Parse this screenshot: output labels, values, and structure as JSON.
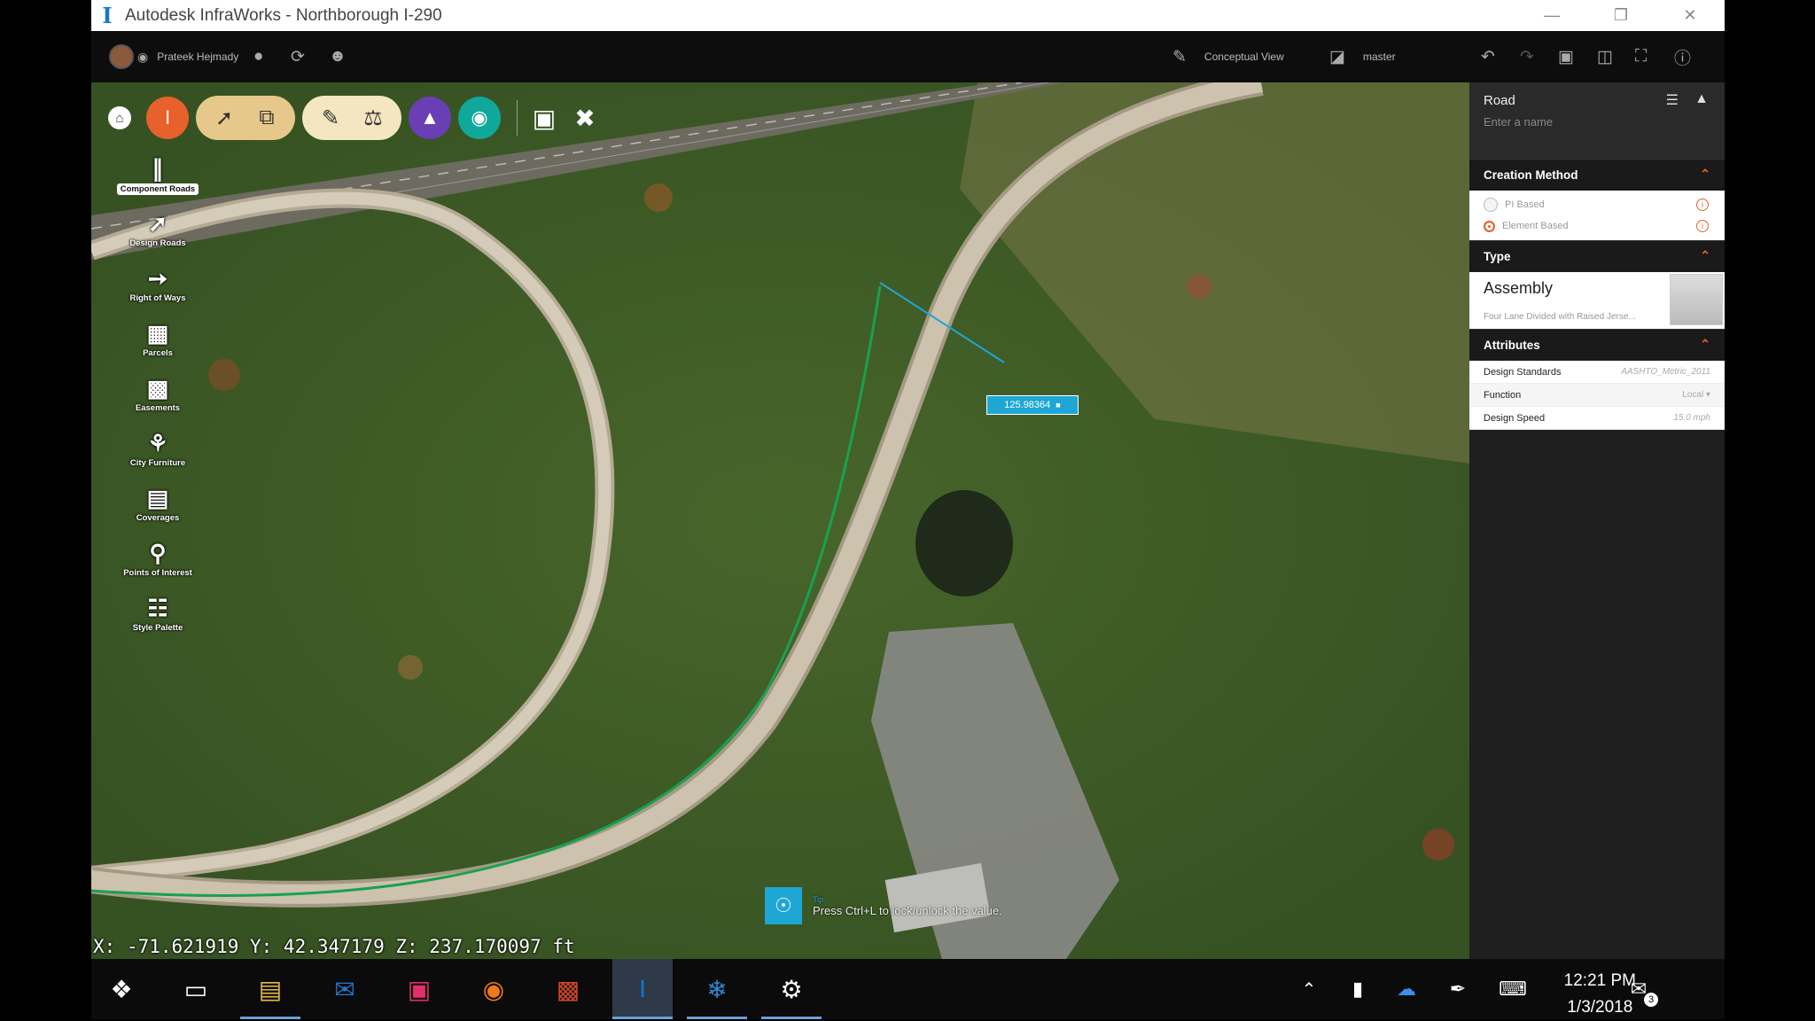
{
  "window": {
    "title": "Autodesk InfraWorks - Northborough I-290",
    "controls": [
      "minimize",
      "restore",
      "close"
    ]
  },
  "topbar": {
    "user_name": "Prateek Hejmady",
    "view_mode": "Conceptual View",
    "branch": "master"
  },
  "toolbar": {
    "buttons": [
      "home-icon",
      "infraworks-icon",
      "road-design-icon",
      "layers-icon",
      "sketch-icon",
      "analyze-icon",
      "bridge-icon",
      "drainage-icon",
      "present-icon",
      "tools-icon"
    ]
  },
  "leftnav": {
    "items": [
      {
        "label": "Component Roads",
        "active": true
      },
      {
        "label": "Design Roads"
      },
      {
        "label": "Right of Ways"
      },
      {
        "label": "Parcels"
      },
      {
        "label": "Easements"
      },
      {
        "label": "City Furniture"
      },
      {
        "label": "Coverages"
      },
      {
        "label": "Points of Interest"
      },
      {
        "label": "Style Palette"
      }
    ]
  },
  "panel": {
    "title": "Road",
    "name_placeholder": "Enter a name",
    "creation_method": {
      "heading": "Creation Method",
      "options": [
        {
          "label": "PI Based",
          "selected": false
        },
        {
          "label": "Element Based",
          "selected": true
        }
      ]
    },
    "type": {
      "heading": "Type",
      "name": "Assembly",
      "description": "Four Lane Divided with Raised Jerse..."
    },
    "attributes": {
      "heading": "Attributes",
      "rows": [
        {
          "label": "Design Standards",
          "value": "AASHTO_Metric_2011"
        },
        {
          "label": "Function",
          "value": "Local"
        },
        {
          "label": "Design Speed",
          "value": "15.0 mph"
        }
      ]
    }
  },
  "viewport": {
    "coordinates": "X: -71.621919 Y: 42.347179 Z: 237.170097 ft",
    "measure_value": "125.98364",
    "tip_label": "Tip",
    "tip_text": "Press Ctrl+L to lock/unlock the value."
  },
  "taskbar": {
    "time": "12:21 PM",
    "date": "1/3/2018",
    "notification_count": "3"
  },
  "colors": {
    "accent_orange": "#e8602c",
    "accent_blue": "#1ea7d4",
    "tool_tan": "#e6c98a",
    "bridge_purple": "#6a3fb5",
    "drainage_teal": "#0fa89a"
  }
}
